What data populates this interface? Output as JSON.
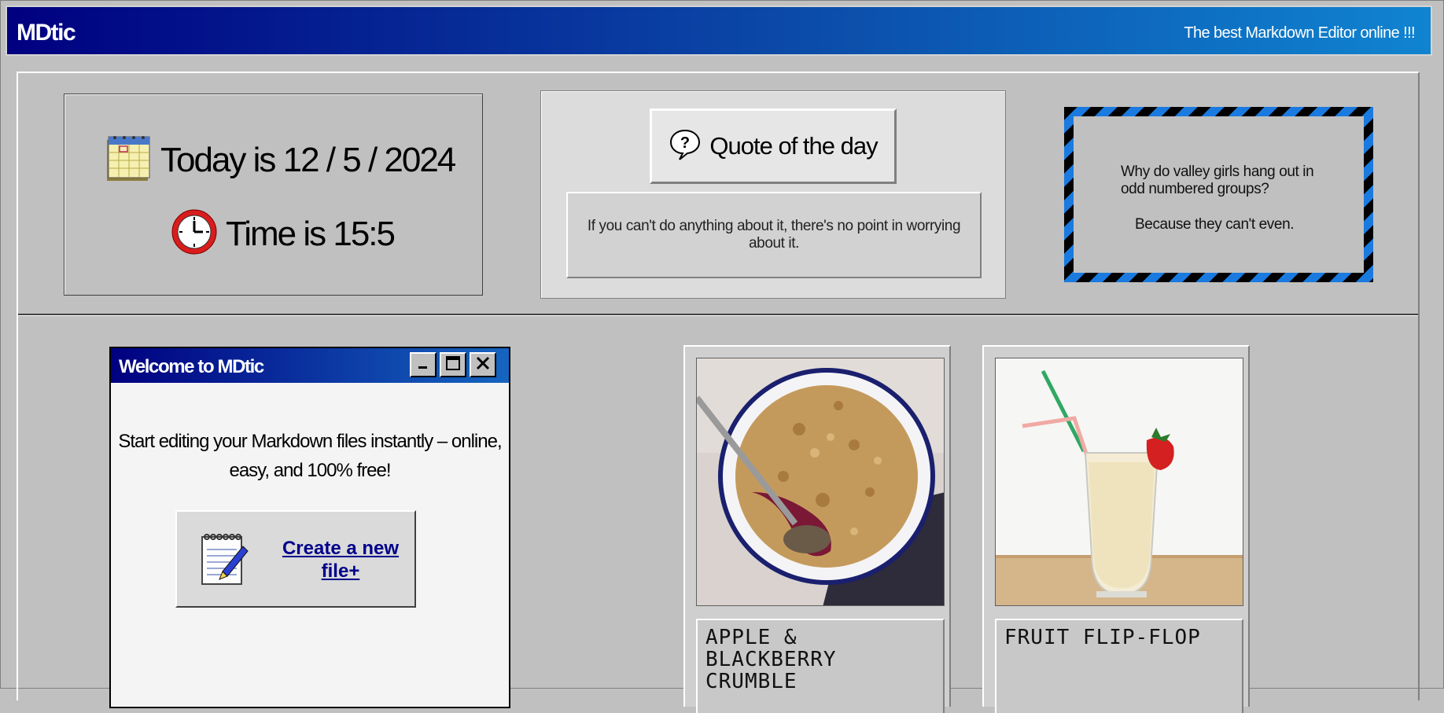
{
  "app": {
    "title": "MDtic",
    "tagline": "The best Markdown Editor online !!!"
  },
  "datetime": {
    "date_text": "Today is 12 / 5 / 2024",
    "time_text": "Time is 15:5",
    "calendar_icon": "calendar-icon",
    "clock_icon": "clock-icon"
  },
  "quote": {
    "header": "Quote of the day",
    "icon": "help-bubble-icon",
    "text": "If you can't do anything about it, there's no point in worrying about it."
  },
  "joke": {
    "question": "Why do valley girls hang out in odd numbered groups?",
    "answer": "Because they can't even."
  },
  "welcome_window": {
    "title": "Welcome to MDtic",
    "buttons": [
      "minimize",
      "maximize",
      "close"
    ],
    "message": "Start editing your Markdown files instantly – online, easy, and 100% free!",
    "create_button_label": "Create a new file+",
    "create_icon": "notepad-pen-icon"
  },
  "recipes": [
    {
      "title": "APPLE & BLACKBERRY CRUMBLE",
      "image": "crumble-photo"
    },
    {
      "title": "FRUIT FLIP-FLOP",
      "image": "milkshake-photo"
    }
  ],
  "colors": {
    "titlebar_start": "#000080",
    "titlebar_end": "#1084d0",
    "face": "#c0c0c0",
    "link": "#00008b",
    "stripe_blue": "#1a7adf"
  }
}
